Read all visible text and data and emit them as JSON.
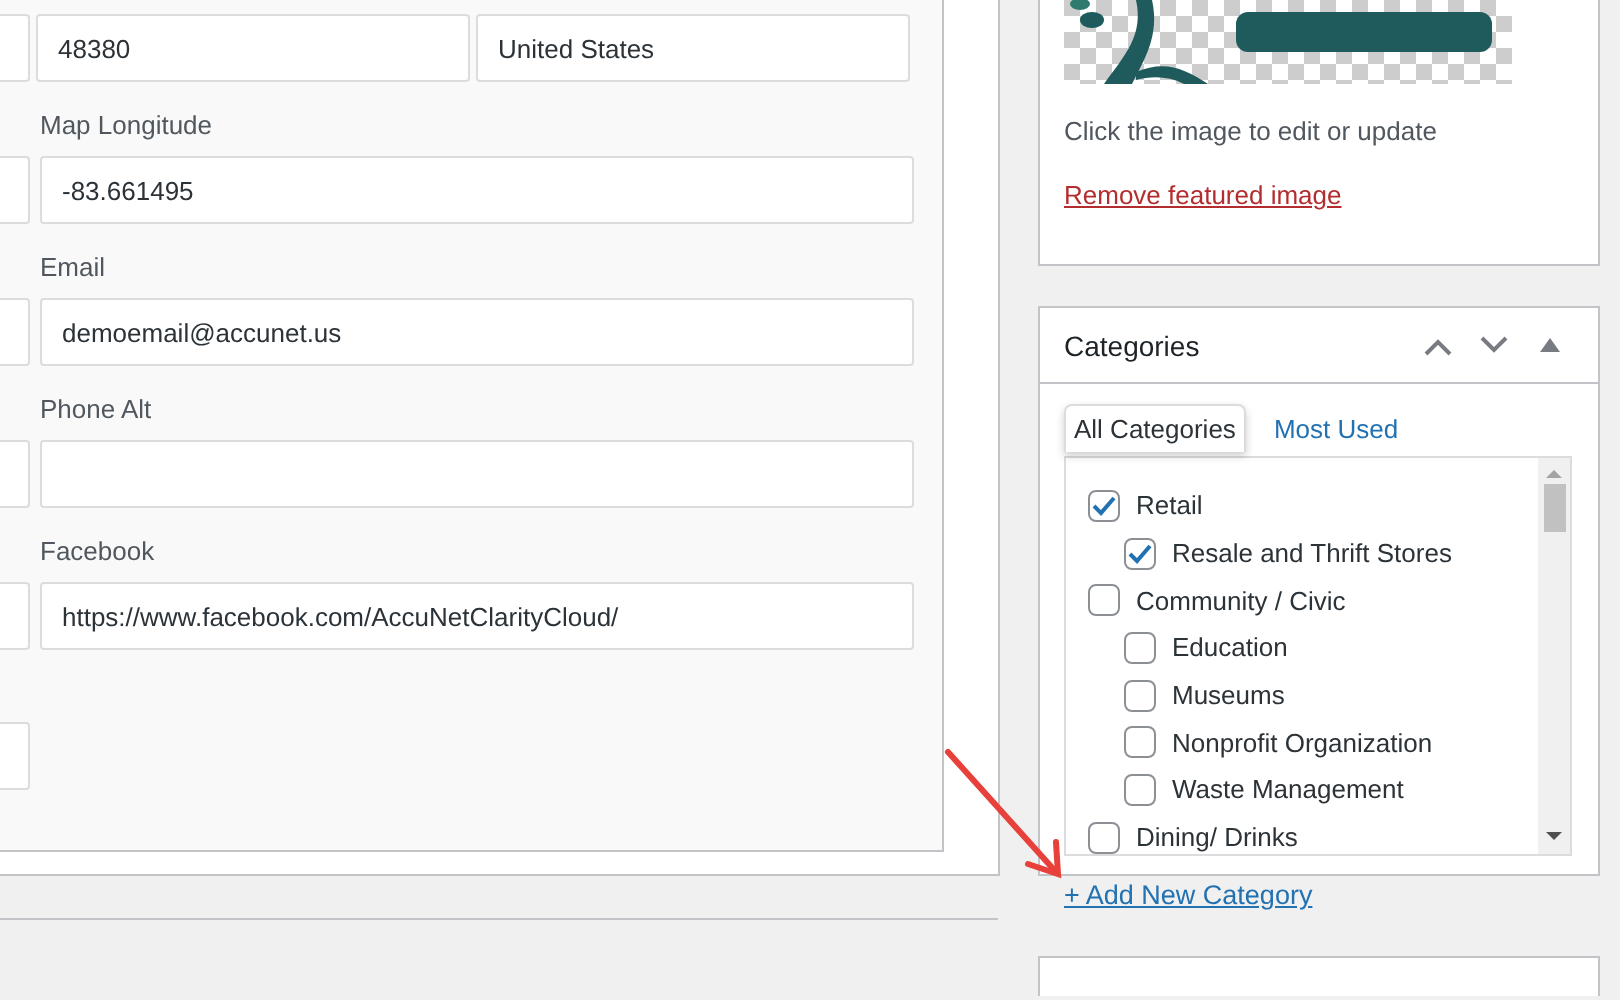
{
  "form": {
    "top_row": [
      {
        "value": "48380"
      },
      {
        "value": "United States"
      }
    ],
    "fields": [
      {
        "label": "Map Longitude",
        "value": "-83.661495"
      },
      {
        "label": "Email",
        "value": "demoemail@accunet.us"
      },
      {
        "label": "Phone Alt"
      },
      {
        "label": "Facebook",
        "value": "https://www.facebook.com/AccuNetClarityCloud/"
      }
    ]
  },
  "featured_image": {
    "hint": "Click the image to edit or update",
    "remove_link": "Remove featured image"
  },
  "categories": {
    "title": "Categories",
    "tabs": [
      {
        "label": "All Categories",
        "selected": true
      },
      {
        "label": "Most Used",
        "selected": false
      }
    ],
    "items": [
      {
        "label": "Retail",
        "checked": true,
        "children": [
          {
            "label": "Resale and Thrift Stores",
            "checked": true
          }
        ]
      },
      {
        "label": "Community / Civic",
        "checked": false,
        "children": [
          {
            "label": "Education",
            "checked": false
          },
          {
            "label": "Museums",
            "checked": false
          },
          {
            "label": "Nonprofit Organization",
            "checked": false
          },
          {
            "label": "Waste Management",
            "checked": false
          }
        ]
      },
      {
        "label": "Dining/ Drinks",
        "checked": false
      }
    ],
    "add_link": "+ Add New Category"
  }
}
